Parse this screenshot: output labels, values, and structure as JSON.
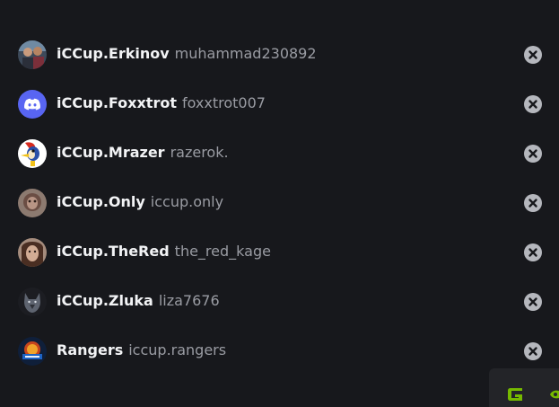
{
  "blocked_users": [
    {
      "display_name": "iCCup.Erkinov",
      "username": "muhammad230892",
      "avatar_icon": "photo-avatar-icon"
    },
    {
      "display_name": "iCCup.Foxxtrot",
      "username": "foxxtrot007",
      "avatar_icon": "discord-logo-icon"
    },
    {
      "display_name": "iCCup.Mrazer",
      "username": "razerok.",
      "avatar_icon": "woodpecker-avatar-icon"
    },
    {
      "display_name": "iCCup.Only",
      "username": "iccup.only",
      "avatar_icon": "photo-avatar-icon"
    },
    {
      "display_name": "iCCup.TheRed",
      "username": "the_red_kage",
      "avatar_icon": "photo-avatar-icon"
    },
    {
      "display_name": "iCCup.Zluka",
      "username": "liza7676",
      "avatar_icon": "wolf-avatar-icon"
    },
    {
      "display_name": "Rangers",
      "username": "iccup.rangers",
      "avatar_icon": "team-logo-avatar-icon"
    }
  ],
  "remove_icon": "remove-x-icon",
  "colors": {
    "background": "#17181c",
    "name_text": "#f2f3f5",
    "username_text": "#9a9ca3",
    "discord_blurple": "#5865f2",
    "overlay_green": "#76b900"
  }
}
